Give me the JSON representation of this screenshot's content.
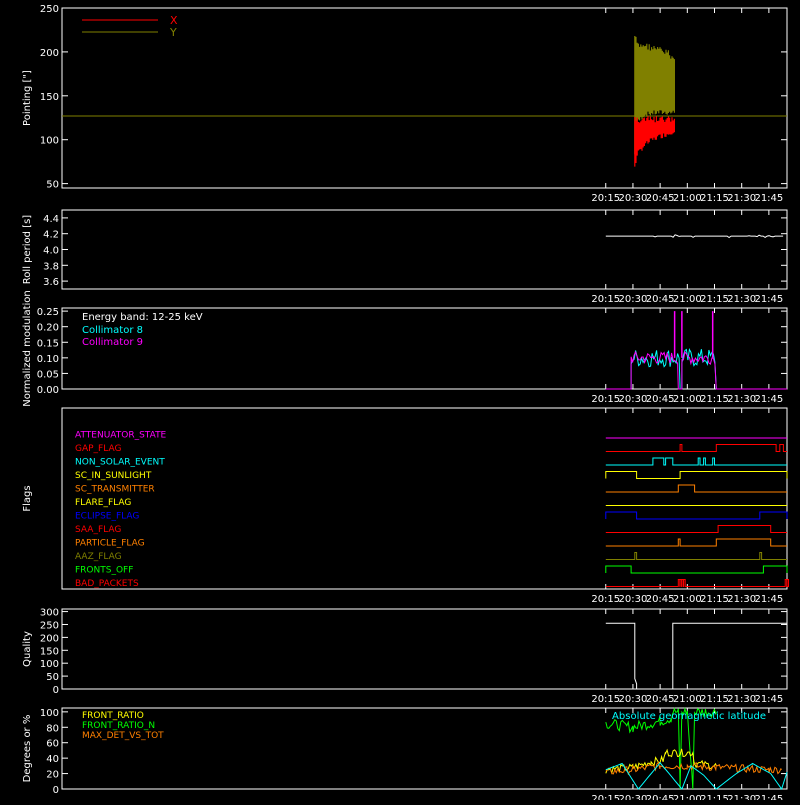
{
  "x_ticks": [
    "20:15",
    "20:30",
    "20:45",
    "21:00",
    "21:15",
    "21:30",
    "21:45"
  ],
  "colors": {
    "background": "#000000",
    "axis": "#ffffff",
    "red": "#ff0000",
    "olive": "#808000",
    "cyan": "#00ffff",
    "magenta": "#ff00ff",
    "green": "#00ff00",
    "yellow": "#ffff00",
    "orange": "#ff8000",
    "blue": "#0000ff",
    "white": "#ffffff"
  },
  "chart_data": [
    {
      "type": "line",
      "id": "pointing",
      "ylabel": "Pointing [\"]",
      "yticks": [
        "50",
        "100",
        "150",
        "200",
        "250"
      ],
      "ylim": [
        45,
        250
      ],
      "xlim": [
        "20:15",
        "21:55"
      ],
      "legend": [
        {
          "name": "X",
          "color": "#ff0000"
        },
        {
          "name": "Y",
          "color": "#808000"
        }
      ],
      "series": [
        {
          "name": "Y",
          "color": "#808000",
          "segments": [
            {
              "x": [
                "20:31",
                "20:33",
                "20:36",
                "20:40",
                "20:45",
                "20:50",
                "20:53"
              ],
              "y_max": [
                222,
                210,
                212,
                209,
                206,
                202,
                195
              ],
              "y_min": [
                80,
                118,
                125,
                127,
                128,
                128,
                128
              ]
            }
          ]
        },
        {
          "name": "X",
          "color": "#ff0000",
          "segments": [
            {
              "x": [
                "20:31",
                "20:33",
                "20:36",
                "20:40",
                "20:45",
                "20:50",
                "20:53"
              ],
              "y_max": [
                128,
                127,
                127,
                127,
                127,
                127,
                127
              ],
              "y_min": [
                68,
                82,
                90,
                96,
                101,
                104,
                108
              ]
            }
          ]
        }
      ],
      "reference_line": {
        "y": 127,
        "color": "#808000"
      }
    },
    {
      "type": "line",
      "id": "roll-period",
      "ylabel": "Roll period [s]",
      "yticks": [
        "3.6",
        "3.8",
        "4.0",
        "4.2",
        "4.4"
      ],
      "ylim": [
        3.5,
        4.5
      ],
      "series": [
        {
          "name": "",
          "color": "#ffffff",
          "x": [
            "20:15",
            "20:40",
            "21:53"
          ],
          "y": [
            4.17,
            4.17,
            4.17
          ],
          "noise_start": "20:40"
        }
      ]
    },
    {
      "type": "line",
      "id": "modulation",
      "ylabel": "Normalized modulation",
      "yticks": [
        "0.00",
        "0.05",
        "0.10",
        "0.15",
        "0.20",
        "0.25"
      ],
      "ylim": [
        0,
        0.26
      ],
      "annotation": "Energy band: 12-25 keV",
      "legend": [
        {
          "name": "Collimator 8",
          "color": "#00ffff"
        },
        {
          "name": "Collimator 9",
          "color": "#ff00ff"
        }
      ],
      "series": [
        {
          "name": "Collimator 8",
          "color": "#00ffff",
          "active": [
            [
              "20:29",
              "20:56"
            ],
            [
              "20:57",
              "21:16"
            ]
          ],
          "level": 0.1,
          "spread": 0.03
        },
        {
          "name": "Collimator 9",
          "color": "#ff00ff",
          "active": [
            [
              "20:29",
              "20:55"
            ],
            [
              "20:57",
              "21:16"
            ]
          ],
          "level": 0.1,
          "spread": 0.02
        }
      ],
      "spikes_c9": [
        [
          "20:53",
          0.25
        ],
        [
          "20:57",
          0.25
        ],
        [
          "21:14",
          0.25
        ]
      ]
    },
    {
      "type": "step",
      "id": "flags",
      "ylabel": "Flags",
      "flags": [
        {
          "name": "ATTENUATOR_STATE",
          "color": "#ff00ff",
          "high": []
        },
        {
          "name": "GAP_FLAG",
          "color": "#ff0000",
          "high": [
            [
              "20:56",
              "20:57"
            ],
            [
              "21:16",
              "21:49"
            ],
            [
              "21:51",
              "21:53"
            ]
          ]
        },
        {
          "name": "NON_SOLAR_EVENT",
          "color": "#00ffff",
          "high": [
            [
              "20:41",
              "20:47"
            ],
            [
              "20:48",
              "20:52"
            ],
            [
              "21:06",
              "21:07"
            ],
            [
              "21:09",
              "21:10"
            ],
            [
              "21:14",
              "21:15"
            ]
          ]
        },
        {
          "name": "SC_IN_SUNLIGHT",
          "color": "#ffff00",
          "high": [
            [
              "20:15",
              "20:32"
            ],
            [
              "20:56",
              "21:55"
            ]
          ]
        },
        {
          "name": "SC_TRANSMITTER",
          "color": "#ff8000",
          "high": [
            [
              "20:55",
              "21:04"
            ]
          ]
        },
        {
          "name": "FLARE_FLAG",
          "color": "#ffff00",
          "high": []
        },
        {
          "name": "ECLIPSE_FLAG",
          "color": "#0000ff",
          "high": [
            [
              "20:15",
              "20:32"
            ],
            [
              "21:40",
              "21:55"
            ]
          ]
        },
        {
          "name": "SAA_FLAG",
          "color": "#ff0000",
          "high": [
            [
              "21:17",
              "21:46"
            ]
          ]
        },
        {
          "name": "PARTICLE_FLAG",
          "color": "#ff8000",
          "high": [
            [
              "20:55",
              "20:56"
            ],
            [
              "21:16",
              "21:46"
            ]
          ]
        },
        {
          "name": "AAZ_FLAG",
          "color": "#808000",
          "high": [
            [
              "20:31",
              "20:32"
            ],
            [
              "21:40",
              "21:41"
            ]
          ]
        },
        {
          "name": "FRONTS_OFF",
          "color": "#00ff00",
          "high": [
            [
              "20:15",
              "20:29"
            ],
            [
              "21:42",
              "21:55"
            ]
          ]
        },
        {
          "name": "BAD_PACKETS",
          "color": "#ff0000",
          "high": [
            [
              "20:55",
              "20:55"
            ],
            [
              "20:56",
              "20:56"
            ],
            [
              "20:57",
              "20:57"
            ],
            [
              "20:58",
              "20:58"
            ],
            [
              "21:54",
              "21:54"
            ],
            [
              "21:55",
              "21:55"
            ]
          ]
        }
      ]
    },
    {
      "type": "line",
      "id": "quality",
      "ylabel": "Quality",
      "yticks": [
        "0",
        "50",
        "100",
        "150",
        "200",
        "250",
        "300"
      ],
      "ylim": [
        0,
        310
      ],
      "series": [
        {
          "name": "",
          "color": "#ffffff",
          "x": [
            "20:15",
            "20:31",
            "20:31",
            "20:32",
            "20:32",
            "20:52",
            "20:52",
            "21:55"
          ],
          "y": [
            255,
            255,
            40,
            20,
            0,
            0,
            255,
            255
          ]
        }
      ]
    },
    {
      "type": "line",
      "id": "ratios",
      "ylabel": "Degrees or %",
      "yticks": [
        "0",
        "20",
        "40",
        "60",
        "80",
        "100"
      ],
      "ylim": [
        0,
        105
      ],
      "legend": [
        {
          "name": "FRONT_RATIO",
          "color": "#ffff00"
        },
        {
          "name": "FRONT_RATIO_N",
          "color": "#00ff00"
        },
        {
          "name": "MAX_DET_VS_TOT",
          "color": "#ff8000"
        }
      ],
      "right_legend": {
        "name": "Absolute geomagnetic latitude",
        "color": "#00ffff"
      },
      "series": [
        {
          "name": "FRONT_RATIO_N",
          "color": "#00ff00",
          "x": [
            "20:15",
            "20:30",
            "20:45",
            "20:51",
            "20:52",
            "20:55",
            "20:56",
            "20:57",
            "21:00",
            "21:03",
            "21:04",
            "21:10",
            "21:16"
          ],
          "y": [
            85,
            80,
            88,
            92,
            100,
            100,
            0,
            100,
            100,
            0,
            100,
            100,
            100
          ]
        },
        {
          "name": "FRONT_RATIO",
          "color": "#ffff00",
          "x": [
            "20:15",
            "20:30",
            "20:40",
            "20:47",
            "20:48",
            "20:55",
            "20:56",
            "21:03",
            "21:04",
            "21:16"
          ],
          "y": [
            25,
            28,
            35,
            38,
            47,
            47,
            47,
            47,
            33,
            30
          ]
        },
        {
          "name": "MAX_DET_VS_TOT",
          "color": "#ff8000",
          "x": [
            "20:15",
            "20:30",
            "20:45",
            "21:00",
            "21:16",
            "21:45",
            "21:52"
          ],
          "y": [
            22,
            25,
            30,
            30,
            28,
            25,
            25
          ]
        },
        {
          "name": "Absolute geomagnetic latitude",
          "color": "#00ffff",
          "x": [
            "20:15",
            "20:24",
            "20:33",
            "20:45",
            "20:57",
            "21:02",
            "21:09",
            "21:16",
            "21:27",
            "21:36",
            "21:46",
            "21:52",
            "21:55"
          ],
          "y": [
            25,
            33,
            0,
            34,
            0,
            30,
            18,
            0,
            20,
            33,
            20,
            0,
            22
          ]
        }
      ]
    }
  ]
}
